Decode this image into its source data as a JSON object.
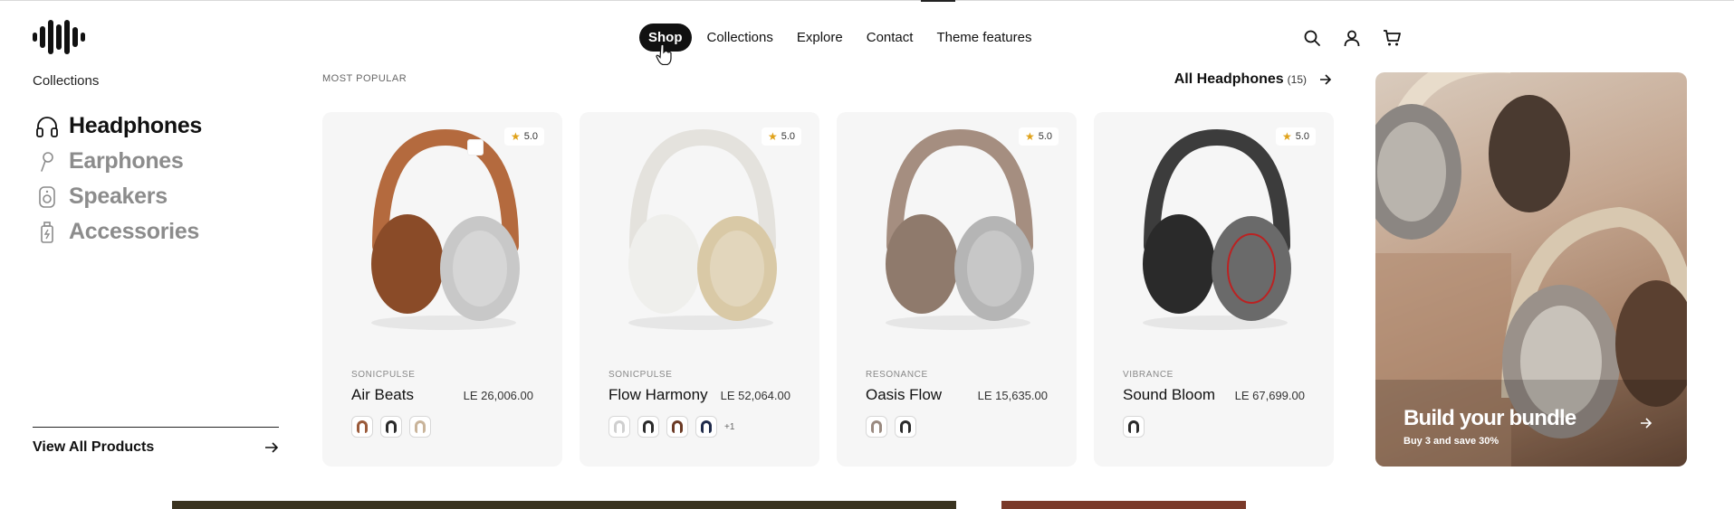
{
  "header": {
    "nav": [
      "Shop",
      "Collections",
      "Explore",
      "Contact",
      "Theme features"
    ],
    "active_nav": "Shop",
    "icons": [
      "search-icon",
      "account-icon",
      "cart-icon"
    ]
  },
  "sidebar": {
    "title": "Collections",
    "items": [
      {
        "label": "Headphones",
        "icon": "headphones-icon",
        "active": true
      },
      {
        "label": "Earphones",
        "icon": "earphones-icon",
        "active": false
      },
      {
        "label": "Speakers",
        "icon": "speaker-icon",
        "active": false
      },
      {
        "label": "Accessories",
        "icon": "accessory-icon",
        "active": false
      }
    ],
    "view_all": "View All Products"
  },
  "products_section": {
    "label": "MOST POPULAR",
    "all_link": "All Headphones",
    "all_count": "(15)"
  },
  "products": [
    {
      "brand": "SONICPULSE",
      "name": "Air Beats",
      "price": "LE 26,006.00",
      "rating": "5.0",
      "colors": {
        "band": "#b46a3e",
        "cup": "#c8c8c8",
        "pad": "#8a4b28"
      },
      "swatches": [
        "#9a5a3a",
        "#2b2b2b",
        "#c9b49a"
      ],
      "more": ""
    },
    {
      "brand": "SONICPULSE",
      "name": "Flow Harmony",
      "price": "LE 52,064.00",
      "rating": "5.0",
      "colors": {
        "band": "#e4e2dd",
        "cup": "#d9c9a6",
        "pad": "#efefec"
      },
      "swatches": [
        "#cfcfcf",
        "#2b2b2b",
        "#6b3a24",
        "#1f2a4a"
      ],
      "more": "+1"
    },
    {
      "brand": "RESONANCE",
      "name": "Oasis Flow",
      "price": "LE 15,635.00",
      "rating": "5.0",
      "colors": {
        "band": "#a58e80",
        "cup": "#b5b5b5",
        "pad": "#8f7a6c"
      },
      "swatches": [
        "#9a8a80",
        "#2b2b2b"
      ],
      "more": ""
    },
    {
      "brand": "VIBRANCE",
      "name": "Sound Bloom",
      "price": "LE 67,699.00",
      "rating": "5.0",
      "colors": {
        "band": "#3c3c3c",
        "cup": "#6a6a6a",
        "pad": "#2a2a2a"
      },
      "swatches": [
        "#2b2b2b"
      ],
      "more": ""
    }
  ],
  "banner": {
    "title": "Build your bundle",
    "subtitle": "Buy 3 and save 30%"
  }
}
